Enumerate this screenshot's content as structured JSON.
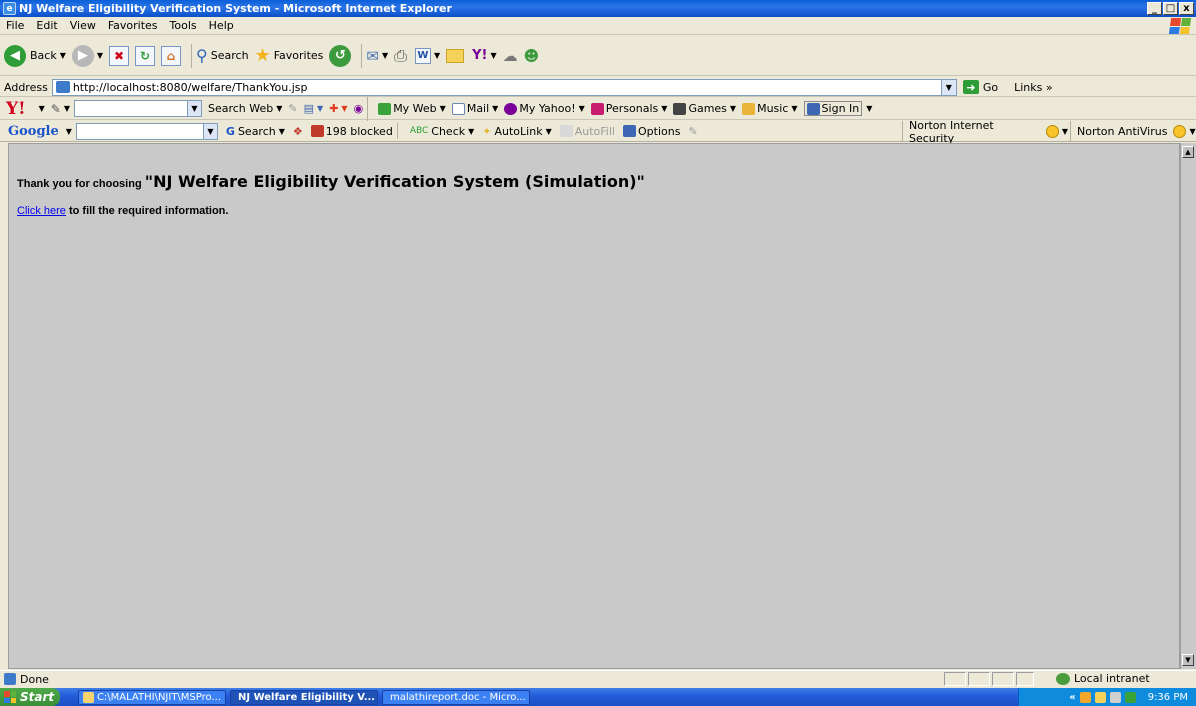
{
  "window": {
    "title": "NJ Welfare Eligibility Verification System - Microsoft Internet Explorer",
    "controls": {
      "minimize": "_",
      "maximize": "□",
      "close": "x"
    }
  },
  "menu": [
    "File",
    "Edit",
    "View",
    "Favorites",
    "Tools",
    "Help"
  ],
  "toolbar": {
    "back": "Back",
    "search": "Search",
    "favorites": "Favorites"
  },
  "address": {
    "label": "Address",
    "url": "http://localhost:8080/welfare/ThankYou.jsp",
    "go": "Go",
    "links": "Links"
  },
  "yahoo": {
    "logo": "Y!",
    "search_web": "Search Web",
    "my_web": "My Web",
    "mail": "Mail",
    "my_yahoo": "My Yahoo!",
    "personals": "Personals",
    "games": "Games",
    "music": "Music",
    "sign_in": "Sign In"
  },
  "google": {
    "logo": "Google",
    "search": "Search",
    "blocked": "198 blocked",
    "check": "Check",
    "autolink": "AutoLink",
    "autofill": "AutoFill",
    "options": "Options",
    "norton_security": "Norton Internet Security",
    "norton_antivirus": "Norton AntiVirus"
  },
  "page": {
    "thanks_lead": "Thank you for choosing ",
    "system_name": "\"NJ Welfare Eligibility Verification System (Simulation)\"",
    "link_text": "Click here",
    "link_rest": " to fill the required information."
  },
  "status": {
    "text": "Done",
    "zone": "Local intranet"
  },
  "taskbar": {
    "start": "Start",
    "items": [
      {
        "label": "C:\\MALATHI\\NJIT\\MSPro...",
        "active": false
      },
      {
        "label": "NJ Welfare Eligibility V...",
        "active": true
      },
      {
        "label": "malathireport.doc - Micro...",
        "active": false
      }
    ],
    "time": "9:36 PM"
  },
  "colors": {
    "titlebar": "#0a5fd8",
    "content_bg": "#c9c9c9",
    "link": "#0000ee",
    "yahoo_red": "#d0021b"
  }
}
